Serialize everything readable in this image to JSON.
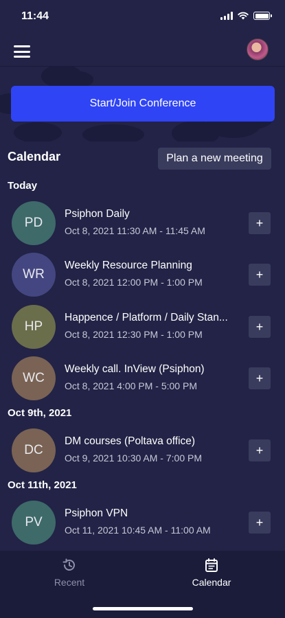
{
  "status_bar": {
    "time": "11:44"
  },
  "conference": {
    "label": "Start/Join Conference"
  },
  "calendar": {
    "title": "Calendar",
    "plan_button": "Plan a new meeting",
    "sections": [
      {
        "label": "Today",
        "meetings": [
          {
            "initials": "PD",
            "title": "Psiphon Daily",
            "time": "Oct 8, 2021 11:30 AM - 11:45 AM",
            "color": "#3e6a6a"
          },
          {
            "initials": "WR",
            "title": "Weekly Resource Planning",
            "time": "Oct 8, 2021 12:00 PM - 1:00 PM",
            "color": "#444681"
          },
          {
            "initials": "HP",
            "title": "Happence / Platform / Daily Stan...",
            "time": "Oct 8, 2021 12:30 PM - 1:00 PM",
            "color": "#6b6e4b"
          },
          {
            "initials": "WC",
            "title": "Weekly call. InView (Psiphon)",
            "time": "Oct 8, 2021 4:00 PM - 5:00 PM",
            "color": "#7a6354"
          }
        ]
      },
      {
        "label": "Oct 9th, 2021",
        "meetings": [
          {
            "initials": "DC",
            "title": "DM courses (Poltava office)",
            "time": "Oct 9, 2021 10:30 AM - 7:00 PM",
            "color": "#7a6354"
          }
        ]
      },
      {
        "label": "Oct 11th, 2021",
        "meetings": [
          {
            "initials": "PV",
            "title": "Psiphon VPN",
            "time": "Oct 11, 2021 10:45 AM - 11:00 AM",
            "color": "#3e6a6a"
          }
        ]
      }
    ],
    "add_label": "+"
  },
  "tabs": {
    "recent": {
      "label": "Recent",
      "icon": "history-icon",
      "color": "#8e8fa8"
    },
    "calendar": {
      "label": "Calendar",
      "icon": "calendar-icon",
      "color": "#ffffff"
    }
  },
  "colors": {
    "background": "#222346",
    "accent": "#2f44f5",
    "button": "#3a3c5e"
  }
}
